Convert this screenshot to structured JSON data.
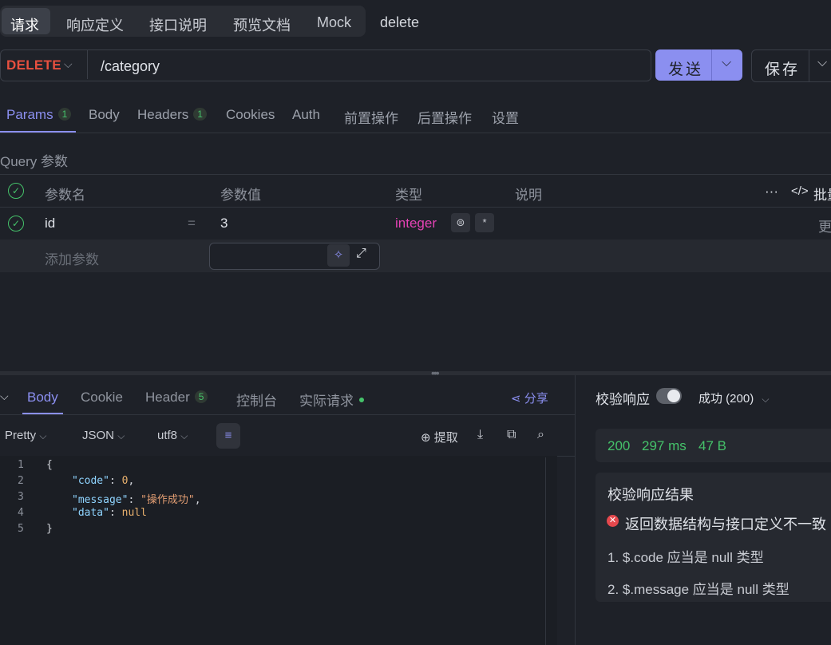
{
  "top_tabs": [
    "请求",
    "响应定义",
    "接口说明",
    "预览文档",
    "Mock"
  ],
  "api_name": "delete",
  "request": {
    "method": "DELETE",
    "url": "/category",
    "send_label": "发送",
    "save_label": "保存"
  },
  "request_tabs": [
    {
      "label": "Params",
      "badge": "1"
    },
    {
      "label": "Body",
      "badge": ""
    },
    {
      "label": "Headers",
      "badge": "1"
    },
    {
      "label": "Cookies",
      "badge": ""
    },
    {
      "label": "Auth",
      "badge": ""
    },
    {
      "label": "前置操作",
      "badge": ""
    },
    {
      "label": "后置操作",
      "badge": ""
    },
    {
      "label": "设置",
      "badge": ""
    }
  ],
  "query": {
    "section_label": "Query 参数",
    "headers": {
      "name": "参数名",
      "value": "参数值",
      "type": "类型",
      "desc": "说明",
      "more": "···",
      "bulk": "批量"
    },
    "rows": [
      {
        "name": "id",
        "eq": "=",
        "value": "3",
        "type": "integer",
        "required": "*",
        "more": "更"
      }
    ],
    "add_placeholder": "添加参数"
  },
  "response": {
    "tabs": [
      {
        "label": "Body",
        "badge": ""
      },
      {
        "label": "Cookie",
        "badge": ""
      },
      {
        "label": "Header",
        "badge": "5"
      },
      {
        "label": "控制台",
        "badge": ""
      },
      {
        "label": "实际请求",
        "badge": ""
      }
    ],
    "share_label": "分享",
    "format": "Pretty",
    "lang": "JSON",
    "encoding": "utf8",
    "extract_label": "提取",
    "code_lines": [
      "1",
      "2",
      "3",
      "4",
      "5"
    ],
    "json": {
      "code_key": "\"code\"",
      "code_val": "0",
      "message_key": "\"message\"",
      "message_val": "\"操作成功\"",
      "data_key": "\"data\"",
      "data_val": "null"
    }
  },
  "verify": {
    "label": "校验响应",
    "status_select": "成功 (200)",
    "status_code": "200",
    "time": "297 ms",
    "size": "47 B",
    "result_title": "校验响应结果",
    "error_text": "返回数据结构与接口定义不一致",
    "items": [
      "1. $.code 应当是 null 类型",
      "2. $.message 应当是 null 类型"
    ]
  },
  "colors": {
    "accent": "#8b8ff0",
    "method_delete": "#e8503f",
    "success": "#45c26a",
    "type_integer": "#e542b5"
  }
}
